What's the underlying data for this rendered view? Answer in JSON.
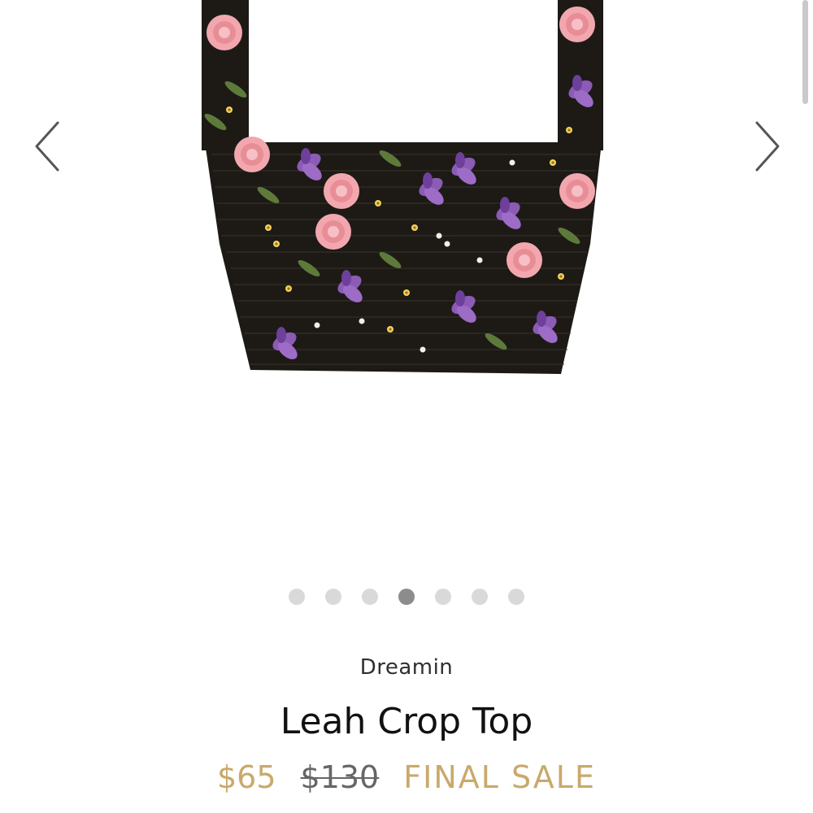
{
  "gallery": {
    "image_alt": "floral smocked crop top",
    "prev_icon": "chevron-left-icon",
    "next_icon": "chevron-right-icon",
    "slide_count": 7,
    "active_slide": 4,
    "colors": {
      "fabric": "#1d1a16",
      "rose": "#f2a7ae",
      "violet": "#8b5bb5",
      "leaf": "#5d7a3a",
      "flower_yellow": "#f1d35a",
      "dot_inactive": "#d9d9d9",
      "dot_active": "#8c8c8c"
    }
  },
  "product": {
    "brand": "Dreamin",
    "title": "Leah Crop Top",
    "price": "$65",
    "original_price": "$130",
    "badge": "FINAL SALE",
    "accent_color": "#c9a96b"
  }
}
